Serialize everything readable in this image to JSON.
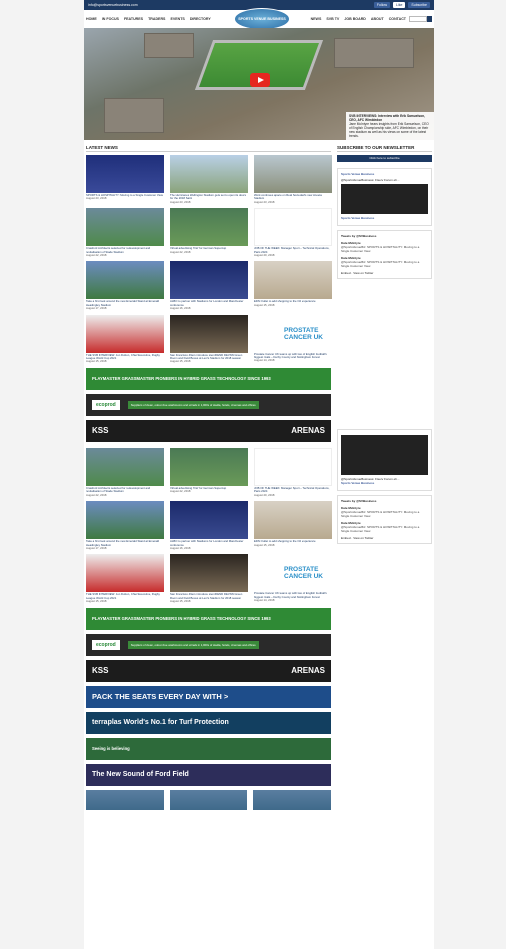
{
  "topbar": {
    "email": "info@sportsvenuebusiness.com",
    "links": [
      "info@sportsvenuebusiness.com",
      "Follow",
      "Like",
      "Subscribe"
    ]
  },
  "nav": {
    "left": [
      "HOME",
      "IN FOCUS",
      "FEATURES",
      "TRADERS",
      "EVENTS",
      "DIRECTORY"
    ],
    "logo": "SPORTS VENUE BUSINESS",
    "right": [
      "NEWS",
      "SVB TV",
      "JOB BOARD",
      "ABOUT",
      "CONTACT"
    ],
    "search_placeholder": "Search"
  },
  "hero": {
    "caption_title": "SVB INTERVIEWS: Interview with Erik Samuelson, CEO, AFC Wimbledon",
    "caption_text": "Jane McIntyre hears insights from Erik Samuelson, CEO of English Championship side, AFC Wimbledon, on their new stadium as well as his views on some of the latest trends."
  },
  "latest_news": {
    "title": "LATEST NEWS",
    "items": [
      {
        "title": "SPORTS & HOSPITALITY: Moving to a Single Customer View",
        "date": "August 23, 2018"
      },
      {
        "title": "The Hurricanes Wellington Stadium gets set to open its doors for the 2018 Saint",
        "date": "August 23, 2018"
      },
      {
        "title": "Work continues apace on Real Sociedad's new Anoeta Stadium",
        "date": "August 23, 2018"
      },
      {
        "title": "Crawford Architects selected for redevelopment and revitalisation of Stade Stadium",
        "date": "August 22, 2018"
      },
      {
        "title": "Virtual advertising 'first' for German Supercup",
        "date": "August 22, 2018"
      },
      {
        "title": "JOB OF THE WEEK: Manager Sport – Technical Operations, Paris 2024",
        "date": "August 20, 2018"
      },
      {
        "title": "Take a first look around the new Emerald Stand at Emerald Headingley Stadium",
        "date": "August 17, 2018"
      },
      {
        "title": "ALBO to partner with Stadiums for London and Manchester conference",
        "date": "August 16, 2018"
      },
      {
        "title": "EDN Outlet to add shopping to the O2 experience",
        "date": "August 15, 2018"
      },
      {
        "title": "THE SVB INTERVIEW: Jon Dutton, Chief Executive, Rugby League World Cup 2021",
        "date": "August 15, 2018"
      },
      {
        "title": "San Francisco 49ers introduce stemFIEND DEVNN Green Room and Field Boxes at Levi's Stadium for 2018 season",
        "date": "August 15, 2018"
      },
      {
        "title": "Prostate Cancer UK teams up with two of English football's biggest rivals – Derby County and Nottingham Forest",
        "date": "August 14, 2018"
      }
    ],
    "items2": [
      {
        "title": "Crawford Architects selected for redevelopment and revitalisation of Stade Stadium",
        "date": "August 22, 2018"
      },
      {
        "title": "Virtual advertising 'first' for German Supercup",
        "date": "August 22, 2018"
      },
      {
        "title": "JOB OF THE WEEK: Manager Sport – Technical Operations, Paris 2024",
        "date": "August 20, 2018"
      },
      {
        "title": "Take a first look around the new Emerald Stand at Emerald Headingley Stadium",
        "date": "August 17, 2018"
      },
      {
        "title": "ALBO to partner with Stadiums for London and Manchester conference",
        "date": "August 16, 2018"
      },
      {
        "title": "EDN Outlet to add shopping to the O2 experience",
        "date": "August 15, 2018"
      },
      {
        "title": "THE SVB INTERVIEW: Jon Dutton, Chief Executive, Rugby League World Cup 2021",
        "date": "August 15, 2018"
      },
      {
        "title": "San Francisco 49ers introduce stemFIEND DEVNN Green Room and Field Boxes at Levi's Stadium for 2018 season",
        "date": "August 15, 2018"
      },
      {
        "title": "Prostate Cancer UK teams up with two of English football's biggest rivals – Derby County and Nottingham Forest",
        "date": "August 14, 2018"
      }
    ]
  },
  "prostate": {
    "line1": "PROSTATE",
    "line2": "CANCER UK"
  },
  "banners": {
    "playmaster": "PLAYMASTER   GRASSMASTER   PIONEERS IN HYBRID GRASS TECHNOLOGY SINCE 1993",
    "eco_brand": "ecoprod",
    "eco_msg": "Suppliers of clean, odour-free washrooms and urinals in 1,000s of stadia, hotels, cinemas and offices",
    "kss_left": "KSS",
    "kss_right": "ARENAS",
    "pack": "PACK THE SEATS EVERY DAY WITH >",
    "terra": "terraplas  World's No.1 for Turf Protection",
    "field": "Seeing is believing",
    "ford": "The New Sound of Ford Field"
  },
  "sidebar": {
    "newsletter_title": "SUBSCRIBE TO OUR NEWSLETTER",
    "subscribe_button": "Click here to subscribe",
    "fb_page": "Sports Venue Business",
    "fb_post_text": "@SportsVenueBusiness: Fiserv Forum eh...",
    "tweets_title": "Tweets",
    "tweets_by": "by @SVBusiness",
    "tweet_user": "Kate McIntyre",
    "tweet_text": "@SportsVenueBiz: SPORTS & HOSPITALITY: Moving to a Single Customer View",
    "embed": "Embed",
    "view_twitter": "View on Twitter"
  }
}
